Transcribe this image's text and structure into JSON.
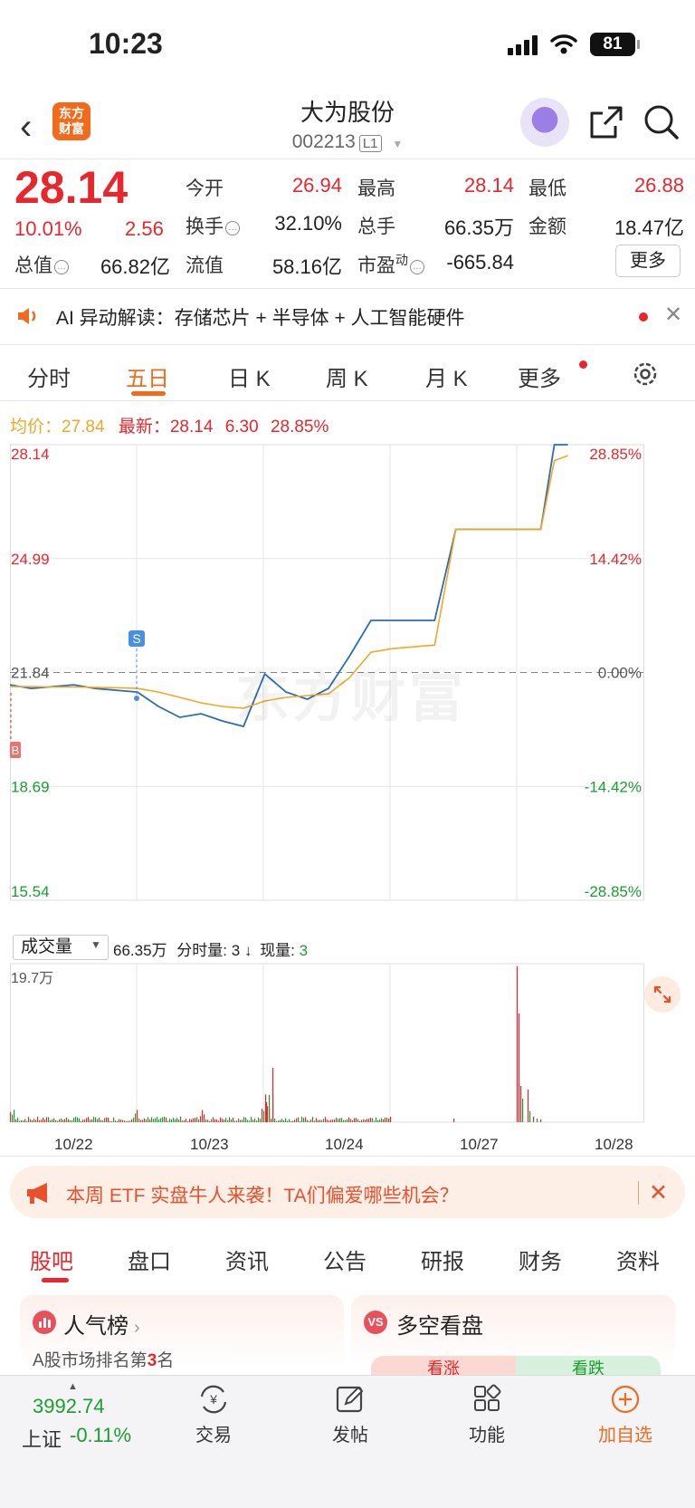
{
  "status": {
    "time": "10:23",
    "battery": "81"
  },
  "header": {
    "logo_line1": "东方",
    "logo_line2": "财富",
    "title": "大为股份",
    "code": "002213",
    "level": "L1"
  },
  "quote": {
    "price": "28.14",
    "pct": "10.01%",
    "change": "2.56",
    "open_label": "今开",
    "open": "26.94",
    "high_label": "最高",
    "high": "28.14",
    "low_label": "最低",
    "low": "26.88",
    "turnover_label": "换手",
    "turnover": "32.10%",
    "volume_label": "总手",
    "volume": "66.35万",
    "amount_label": "金额",
    "amount": "18.47亿",
    "mktcap_label": "总值",
    "mktcap": "66.82亿",
    "float_label": "流值",
    "float_cap": "58.16亿",
    "pe_label": "市盈",
    "pe_sup": "动",
    "pe": "-665.84",
    "more": "更多"
  },
  "ai_banner": {
    "label": "AI 异动解读：",
    "text": "存储芯片 + 半导体 + 人工智能硬件"
  },
  "chart_tabs": [
    "分时",
    "五日",
    "日 K",
    "周 K",
    "月 K",
    "更多"
  ],
  "info_line": {
    "avg_label": "均价：",
    "avg": "27.84",
    "last_label": "最新：",
    "last": "28.14",
    "chg": "6.30",
    "pct": "28.85%"
  },
  "chart_data": {
    "type": "line",
    "xlabels": [
      "10/22",
      "10/23",
      "10/24",
      "10/27",
      "10/28"
    ],
    "ylim": [
      15.54,
      28.14
    ],
    "y_ticks_left": [
      "28.14",
      "24.99",
      "21.84",
      "18.69",
      "15.54"
    ],
    "y_ticks_right": [
      "28.85%",
      "14.42%",
      "0.00%",
      "-14.42%",
      "-28.85%"
    ],
    "prev_close": 21.84,
    "series": [
      {
        "name": "price",
        "color": "#2b6cb8",
        "values": [
          21.5,
          21.4,
          21.45,
          21.5,
          21.4,
          21.35,
          21.3,
          20.9,
          20.6,
          20.7,
          20.5,
          20.35,
          21.8,
          21.3,
          21.1,
          21.4,
          22.3,
          23.28,
          23.28,
          23.28,
          23.28,
          25.8,
          25.8,
          25.8,
          25.8,
          25.8,
          28.14,
          28.14
        ]
      },
      {
        "name": "avg",
        "color": "#f5a623",
        "values": [
          21.45,
          21.45,
          21.44,
          21.44,
          21.43,
          21.42,
          21.4,
          21.3,
          21.15,
          21.0,
          20.9,
          20.85,
          21.05,
          21.15,
          21.2,
          21.25,
          21.7,
          22.4,
          22.5,
          22.55,
          22.6,
          25.8,
          25.8,
          25.8,
          25.8,
          25.8,
          27.7,
          27.84
        ]
      }
    ]
  },
  "volume": {
    "select": "成交量",
    "total": "66.35万",
    "period_label": "分时量:",
    "period": "3",
    "now_label": "现量:",
    "now": "3",
    "max": "19.7万"
  },
  "etf_banner": {
    "text": "本周 ETF 实盘牛人来袭！TA们偏爱哪些机会？"
  },
  "bottom_tabs": [
    "股吧",
    "盘口",
    "资讯",
    "公告",
    "研报",
    "财务",
    "资料"
  ],
  "cards": {
    "rank_title": "人气榜",
    "rank_text_pre": "A股市场排名第",
    "rank_num": "3",
    "rank_text_post": "名",
    "vs_icon": "VS",
    "vs_title": "多空看盘",
    "bull": "看涨",
    "bear": "看跌"
  },
  "bottom_nav": {
    "index_val": "3992.74",
    "index_label": "上证",
    "index_pct": "-0.11%",
    "items": [
      "交易",
      "发帖",
      "功能",
      "加自选"
    ]
  },
  "colors": {
    "up": "#e8262c",
    "down": "#1a9e2f",
    "accent": "#f26b1d",
    "avg": "#f5a623",
    "price": "#2b6cb8"
  }
}
